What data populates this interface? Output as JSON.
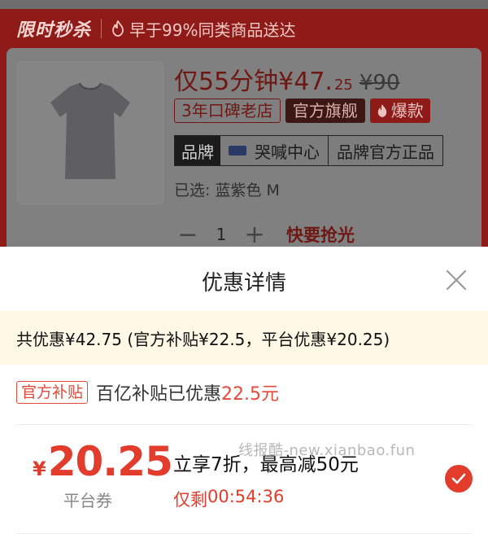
{
  "flash": {
    "title": "限时秒杀",
    "subtitle": "早于99%同类商品送达"
  },
  "product": {
    "price_prefix": "仅55分钟¥47.",
    "price_cents": "25",
    "original_price": "¥90",
    "tags": [
      "3年口碑老店",
      "官方旗舰",
      "爆款"
    ],
    "brand_label": "品牌",
    "brand_name": "哭喊中心",
    "brand_official": "品牌官方正品",
    "selected": "已选: 蓝紫色 M",
    "quantity": "1",
    "qty_hint": "快要抢光"
  },
  "sheet": {
    "title": "优惠详情",
    "summary": "共优惠¥42.75 (官方补贴¥22.5，平台优惠¥20.25)",
    "subsidy_tag": "官方补贴",
    "subsidy_text": "百亿补贴已优惠",
    "subsidy_amount": "22.5元",
    "coupon": {
      "currency": "¥",
      "amount": "20.25",
      "type": "平台券",
      "desc": "立享7折，最高减50元",
      "timer_prefix": "仅剩",
      "timer": "00:54:36"
    },
    "watermark": "线报酷-new.xianbao.fun"
  },
  "colors": {
    "accent": "#e23c2c",
    "summary_bg": "#fff8e6"
  }
}
